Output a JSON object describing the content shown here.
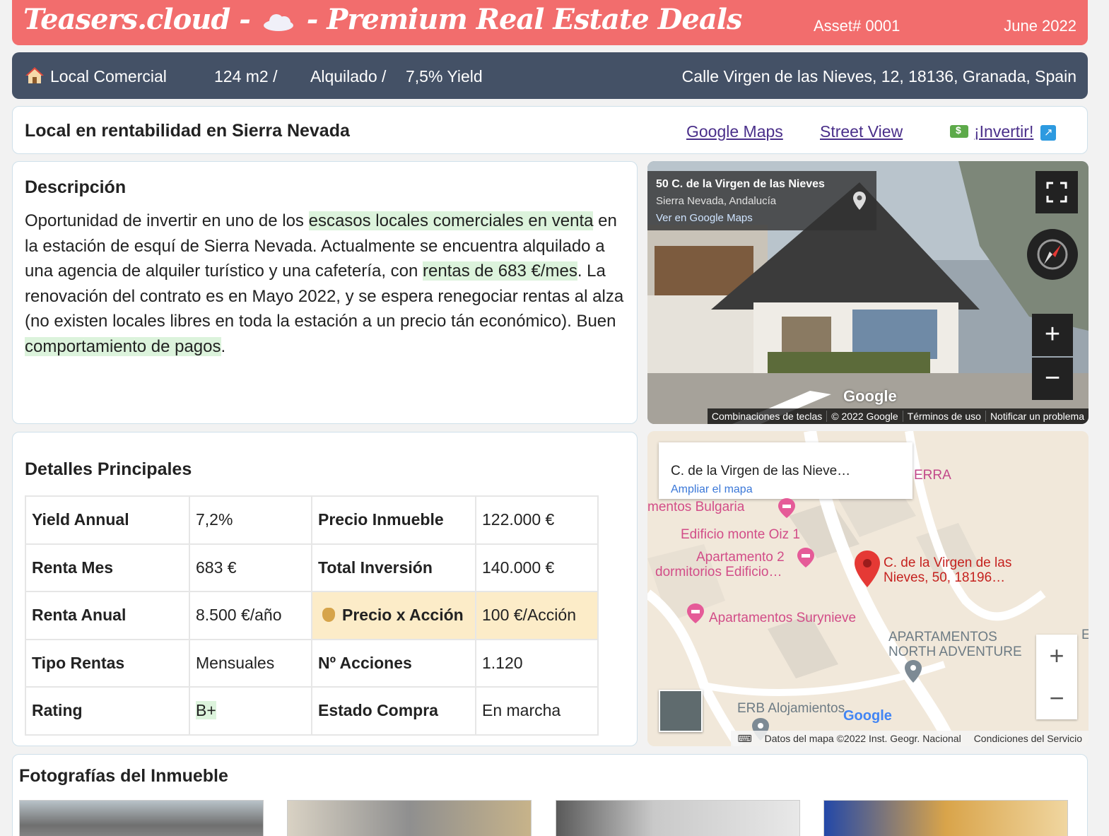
{
  "banner": {
    "brand_left": "Teasers.cloud -",
    "brand_right": "- Premium Real Estate Deals",
    "asset": "Asset# 0001",
    "date": "June 2022",
    "color": "#f26d6d"
  },
  "infobar": {
    "type": "Local Comercial",
    "area": "124 m2 /",
    "status": "Alquilado /",
    "yield": "7,5% Yield",
    "address": "Calle Virgen de las Nieves, 12, 18136, Granada, Spain",
    "color": "#445166"
  },
  "titlebar": {
    "title": "Local en rentabilidad en Sierra Nevada",
    "google_maps": "Google Maps",
    "street_view": "Street View",
    "invest": "¡Invertir!"
  },
  "description": {
    "heading": "Descripción",
    "parts": [
      "Oportunidad de invertir en uno de los ",
      "escasos locales comerciales en venta",
      " en la estación de esquí de Sierra Nevada. Actualmente se encuentra alquilado a una agencia de alquiler turístico y una cafetería, con ",
      "rentas de 683 €/mes",
      ". La renovación del contrato es en Mayo 2022, y se espera renegociar rentas al alza (no existen locales libres en toda la estación a un precio tán económico). Buen ",
      "comportamiento de pagos",
      "."
    ]
  },
  "streetview": {
    "title": "50 C. de la Virgen de las Nieves",
    "subtitle": "Sierra Nevada, Andalucía",
    "link": "Ver en Google Maps",
    "google": "Google",
    "footer": [
      "Combinaciones de teclas",
      "© 2022 Google",
      "Términos de uso",
      "Notificar un problema"
    ]
  },
  "details": {
    "heading": "Detalles Principales",
    "rows": [
      {
        "k1": "Yield Annual",
        "v1": "7,2%",
        "k2": "Precio Inmueble",
        "v2": "122.000 €"
      },
      {
        "k1": "Renta Mes",
        "v1": "683 €",
        "k2": "Total Inversión",
        "v2": "140.000 €"
      },
      {
        "k1": "Renta Anual",
        "v1": "8.500 €/año",
        "k2": "Precio x Acción",
        "v2": "100 €/Acción"
      },
      {
        "k1": "Tipo Rentas",
        "v1": "Mensuales",
        "k2": "Nº Acciones",
        "v2": "1.120"
      },
      {
        "k1": "Rating",
        "v1": "B+",
        "k2": "Estado Compra",
        "v2": "En marcha"
      }
    ]
  },
  "map": {
    "card_title": "C. de la Virgen de las Nieve…",
    "card_link": "Ampliar el mapa",
    "pois": [
      "mentos Bulgaria",
      "Edificio monte Oiz 1",
      "Apartamento 2",
      "dormitorios Edificio…",
      "Apartamentos Surynieve",
      "ERB Alojamientos"
    ],
    "areas": [
      "ERRA",
      "APARTAMENTOS",
      "NORTH ADVENTURE",
      "E"
    ],
    "pin_label": [
      "C. de la Virgen de las",
      "Nieves, 50, 18196…"
    ],
    "google": "Google",
    "footer": [
      "Datos del mapa ©2022 Inst. Geogr. Nacional",
      "Condiciones del Servicio"
    ]
  },
  "photos": {
    "heading": "Fotografías del Inmueble"
  }
}
